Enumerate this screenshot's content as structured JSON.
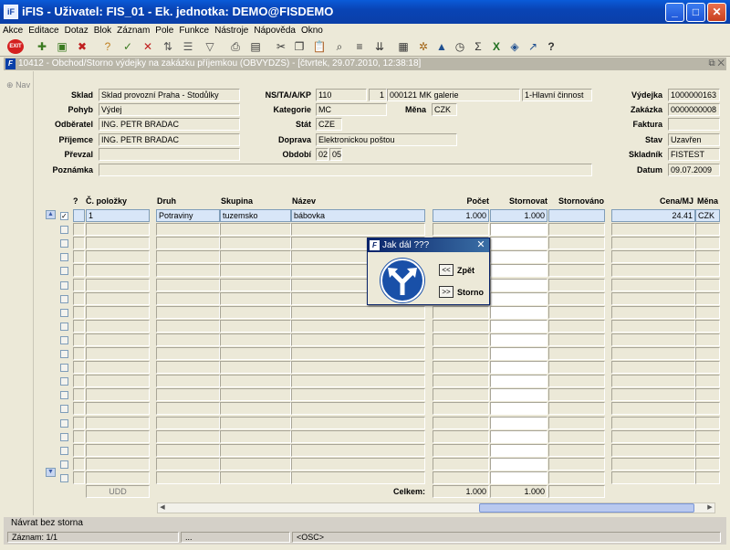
{
  "window": {
    "title": "iFIS - Uživatel: FIS_01 - Ek. jednotka: DEMO@FISDEMO",
    "app_icon": "iFIS-logo-icon",
    "controls": [
      "minimize-icon",
      "maximize-icon",
      "close-icon"
    ]
  },
  "menu": [
    "Akce",
    "Editace",
    "Dotaz",
    "Blok",
    "Záznam",
    "Pole",
    "Funkce",
    "Nástroje",
    "Nápověda",
    "Okno"
  ],
  "toolbar": {
    "exit_label": "EXIT",
    "icons": [
      "new-record-icon",
      "save-record-icon",
      "delete-record-icon",
      "enter-query-icon",
      "execute-query-icon",
      "cancel-query-icon",
      "filter-icon",
      "print-icon",
      "print-preview-icon",
      "cut-icon",
      "copy-icon",
      "paste-icon",
      "find-icon",
      "list-icon",
      "first-record-icon",
      "calculator-icon",
      "settings-icon",
      "chart-icon",
      "clock-icon",
      "sum-icon",
      "excel-icon",
      "tools-icon",
      "help-icon",
      "whats-this-icon"
    ]
  },
  "subwindow": {
    "title": "10412 - Obchod/Storno výdejky na zakázku příjemkou (OBVYDZS) - [čtvrtek, 29.07.2010, 12:38:18]"
  },
  "nav_label": "Nav",
  "form": {
    "sklad_label": "Sklad",
    "sklad_value": "Sklad provozní Praha - Stodůlky",
    "pohyb_label": "Pohyb",
    "pohyb_value": "Výdej",
    "odberatel_label": "Odběratel",
    "odberatel_value": "ING. PETR BRADAC",
    "prijemce_label": "Příjemce",
    "prijemce_value": "ING. PETR BRADAC",
    "prevzal_label": "Převzal",
    "prevzal_value": "",
    "poznamka_label": "Poznámka",
    "poznamka_value": "",
    "ns_label": "NS/TA/A/KP",
    "ns_value": "110",
    "ta_value": "1",
    "a_value": "000121 MK galerie",
    "kp_value": "1-Hlavní činnost",
    "kategorie_label": "Kategorie",
    "kategorie_value": "MC",
    "mena_label": "Měna",
    "mena_value": "CZK",
    "stat_label": "Stát",
    "stat_value": "CZE",
    "doprava_label": "Doprava",
    "doprava_value": "Elektronickou poštou",
    "obdobi_label": "Období",
    "obdobi_month": "02",
    "obdobi_year": "05",
    "vydejka_label": "Výdejka",
    "vydejka_value": "1000000163",
    "zakazka_label": "Zakázka",
    "zakazka_value": "0000000008",
    "faktura_label": "Faktura",
    "faktura_value": "",
    "stav_label": "Stav",
    "stav_value": "Uzavřen",
    "skladnik_label": "Skladník",
    "skladnik_value": "FISTEST",
    "datum_label": "Datum",
    "datum_value": "09.07.2009"
  },
  "table": {
    "headers": {
      "q": "?",
      "polozka": "Č. položky",
      "druh": "Druh",
      "skupina": "Skupina",
      "nazev": "Název",
      "pocet": "Počet",
      "stornovat": "Stornovat",
      "stornovano": "Stornováno",
      "cena": "Cena/MJ",
      "mena": "Měna"
    },
    "rows": [
      {
        "checked": true,
        "polozka": "1",
        "druh": "Potraviny",
        "skupina": "tuzemsko",
        "nazev": "bábovka",
        "pocet": "1.000",
        "stornovat": "1.000",
        "stornovano": "",
        "cena": "24.41",
        "mena": "CZK"
      }
    ],
    "empty_rows": 19
  },
  "footer": {
    "udd_label": "UDD",
    "celkem_label": "Celkem:",
    "celkem_pocet": "1.000",
    "celkem_stornovat": "1.000",
    "celkem_stornovano": ""
  },
  "dialog": {
    "title": "Jak dál ???",
    "btn_back_glyph": "<<",
    "btn_back_label": "Zpět",
    "btn_storno_glyph": ">>",
    "btn_storno_label": "Storno",
    "icon": "fork-arrows-icon"
  },
  "status": {
    "message": "Návrat bez storna",
    "record": "Záznam: 1/1",
    "seg2": "...",
    "seg3": "<OSC>"
  },
  "colors": {
    "titlebar": "#0944b5",
    "selected_row": "#d8e6f8",
    "sign_blue": "#1950a8"
  }
}
